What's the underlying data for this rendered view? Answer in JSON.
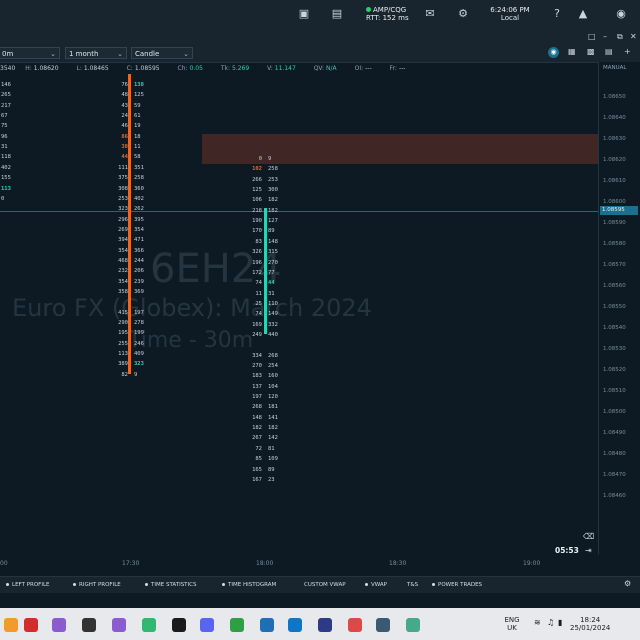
{
  "header": {
    "connection": "AMP/CQG",
    "rtt": "RTT: 152 ms",
    "time": "6:24:06 PM",
    "time_zone": "Local"
  },
  "selectors": {
    "interval": "0m",
    "range": "1 month",
    "style": "Candle"
  },
  "info": {
    "open_partial": "3540",
    "high_label": "H:",
    "high": "1.08620",
    "low_label": "L:",
    "low": "1.08465",
    "close_label": "C:",
    "close": "1.08595",
    "ch_label": "Ch:",
    "ch": "0.05",
    "tk_label": "Tk:",
    "tk": "5.269",
    "v_label": "V:",
    "v": "11.147",
    "qv_label": "QV:",
    "qv": "N/A",
    "oi_label": "OI:",
    "oi": "---",
    "fr_label": "Fr:",
    "fr": "---"
  },
  "watermark": {
    "symbol": "6EH24",
    "description": "Euro FX (Globex): March 2024",
    "timeframe": "Time - 30m"
  },
  "axis_mode": "MANUAL",
  "price_ticks": [
    "1.08650",
    "1.08640",
    "1.08630",
    "1.08620",
    "1.08610",
    "1.08600",
    "1.08590",
    "1.08580",
    "1.08570",
    "1.08560",
    "1.08550",
    "1.08540",
    "1.08530",
    "1.08520",
    "1.08510",
    "1.08500",
    "1.08490",
    "1.08480",
    "1.08470",
    "1.08460"
  ],
  "current_price": "1.08595",
  "time_ticks": [
    "00",
    "17:30",
    "18:00",
    "18:30",
    "19:00"
  ],
  "countdown": "05:53",
  "columns": {
    "left_partial": [
      "146",
      "265",
      "217",
      "67",
      "75",
      "96",
      "31",
      "118",
      "402",
      "155",
      "113",
      "0"
    ],
    "c1_left": [
      "76",
      "48",
      "43",
      "24",
      "46",
      "86",
      "38",
      "44",
      "111",
      "375",
      "308",
      "253",
      "323",
      "296",
      "269",
      "394",
      "354",
      "468",
      "232",
      "354",
      "358",
      "",
      "415",
      "290",
      "195",
      "255",
      "113",
      "389",
      "82"
    ],
    "c1_right": [
      "138",
      "125",
      "59",
      "61",
      "19",
      "18",
      "11",
      "58",
      "351",
      "258",
      "360",
      "402",
      "262",
      "395",
      "354",
      "471",
      "366",
      "244",
      "206",
      "239",
      "369",
      "",
      "197",
      "278",
      "199",
      "246",
      "409",
      "323",
      "9"
    ],
    "c2_left": [
      "0",
      "102",
      "266",
      "125",
      "106",
      "218",
      "190",
      "170",
      "83",
      "326",
      "196",
      "172",
      "74",
      "11",
      "25",
      "74",
      "169",
      "249",
      "",
      "334",
      "270",
      "183",
      "137",
      "197",
      "268",
      "148",
      "182",
      "267",
      "72",
      "85",
      "165",
      "167"
    ],
    "c2_right": [
      "9",
      "258",
      "253",
      "300",
      "182",
      "182",
      "127",
      "89",
      "148",
      "315",
      "270",
      "77",
      "44",
      "31",
      "110",
      "149",
      "332",
      "440",
      "",
      "268",
      "254",
      "160",
      "104",
      "120",
      "181",
      "141",
      "182",
      "142",
      "81",
      "109",
      "89",
      "23"
    ]
  },
  "tabs": [
    "LEFT PROFILE",
    "RIGHT PROFILE",
    "TIME STATISTICS",
    "TIME HISTOGRAM",
    "CUSTOM VWAP",
    "VWAP",
    "T&S",
    "POWER TRADES"
  ],
  "taskbar": {
    "lang": "ENG",
    "region": "UK",
    "time": "18:24",
    "date": "25/01/2024"
  }
}
